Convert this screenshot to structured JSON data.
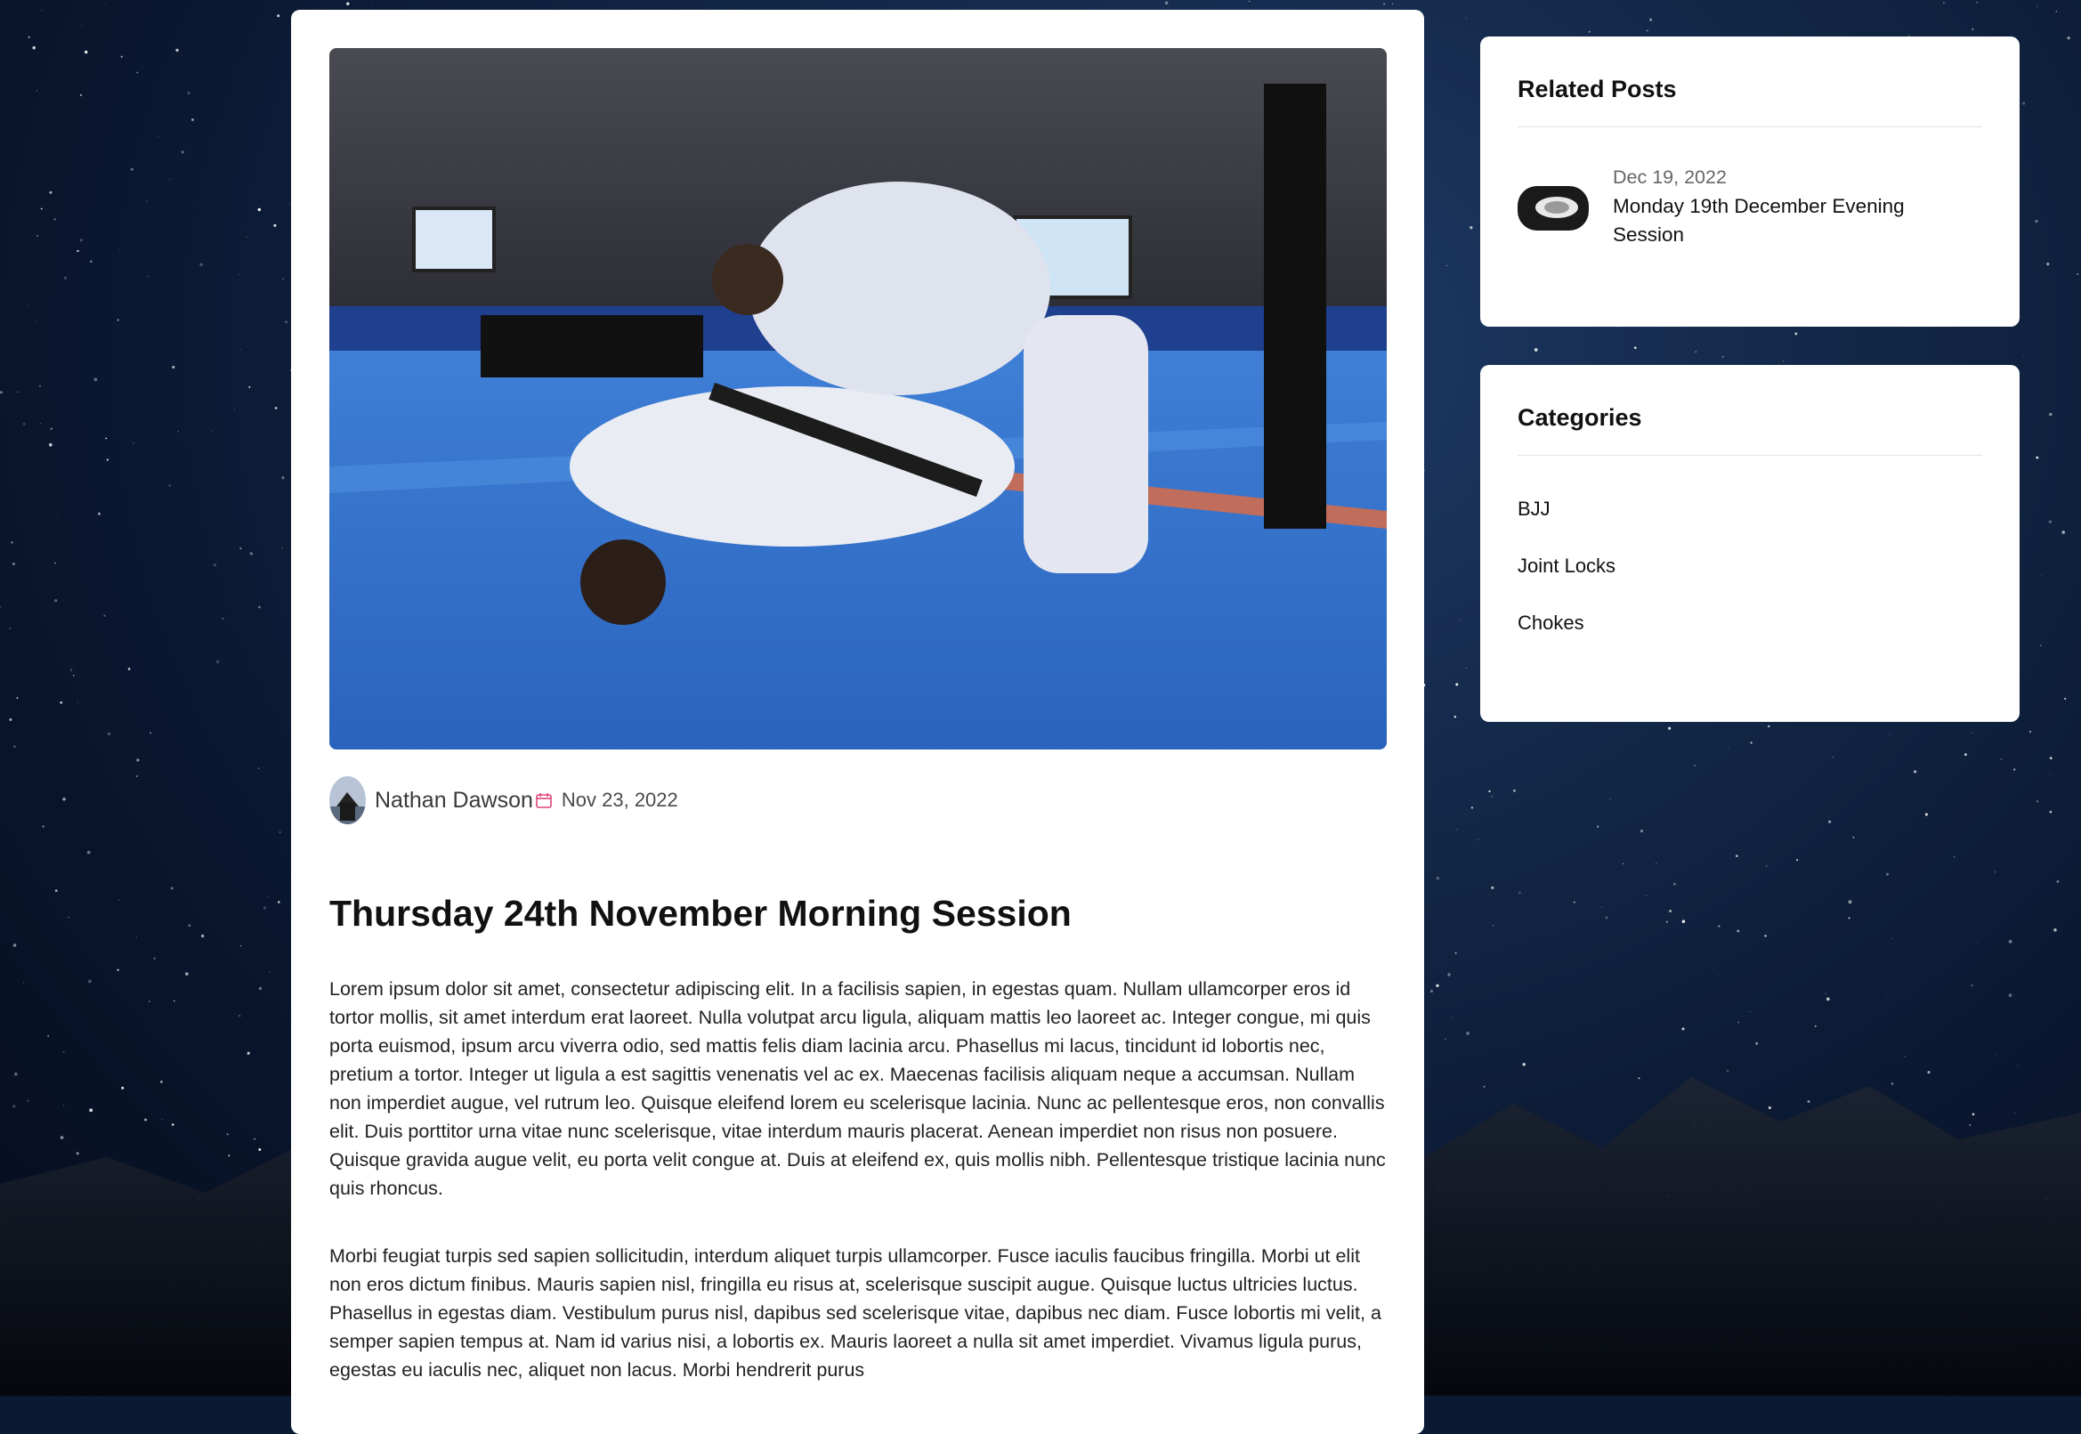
{
  "post": {
    "author": "Nathan Dawson",
    "date": "Nov 23, 2022",
    "title": "Thursday 24th November Morning Session",
    "paragraphs": [
      "Lorem ipsum dolor sit amet, consectetur adipiscing elit. In a facilisis sapien, in egestas quam. Nullam ullamcorper eros id tortor mollis, sit amet interdum erat laoreet. Nulla volutpat arcu ligula, aliquam mattis leo laoreet ac. Integer congue, mi quis porta euismod, ipsum arcu viverra odio, sed mattis felis diam lacinia arcu. Phasellus mi lacus, tincidunt id lobortis nec, pretium a tortor. Integer ut ligula a est sagittis venenatis vel ac ex. Maecenas facilisis aliquam neque a accumsan. Nullam non imperdiet augue, vel rutrum leo. Quisque eleifend lorem eu scelerisque lacinia. Nunc ac pellentesque eros, non convallis elit. Duis porttitor urna vitae nunc scelerisque, vitae interdum mauris placerat. Aenean imperdiet non risus non posuere. Quisque gravida augue velit, eu porta velit congue at. Duis at eleifend ex, quis mollis nibh. Pellentesque tristique lacinia nunc quis rhoncus.",
      "Morbi feugiat turpis sed sapien sollicitudin, interdum aliquet turpis ullamcorper. Fusce iaculis faucibus fringilla. Morbi ut elit non eros dictum finibus. Mauris sapien nisl, fringilla eu risus at, scelerisque suscipit augue. Quisque luctus ultricies luctus. Phasellus in egestas diam. Vestibulum purus nisl, dapibus sed scelerisque vitae, dapibus nec diam. Fusce lobortis mi velit, a semper sapien tempus at. Nam id varius nisi, a lobortis ex. Mauris laoreet a nulla sit amet imperdiet. Vivamus ligula purus, egestas eu iaculis nec, aliquet non lacus. Morbi hendrerit purus"
    ]
  },
  "sidebar": {
    "related": {
      "title": "Related Posts",
      "items": [
        {
          "date": "Dec 19, 2022",
          "title": "Monday 19th December Evening Session"
        }
      ]
    },
    "categories": {
      "title": "Categories",
      "items": [
        "BJJ",
        "Joint Locks",
        "Chokes"
      ]
    }
  },
  "icons": {
    "calendar": "calendar-icon"
  },
  "colors": {
    "calendar_accent": "#e0457b",
    "card_bg": "#ffffff"
  }
}
